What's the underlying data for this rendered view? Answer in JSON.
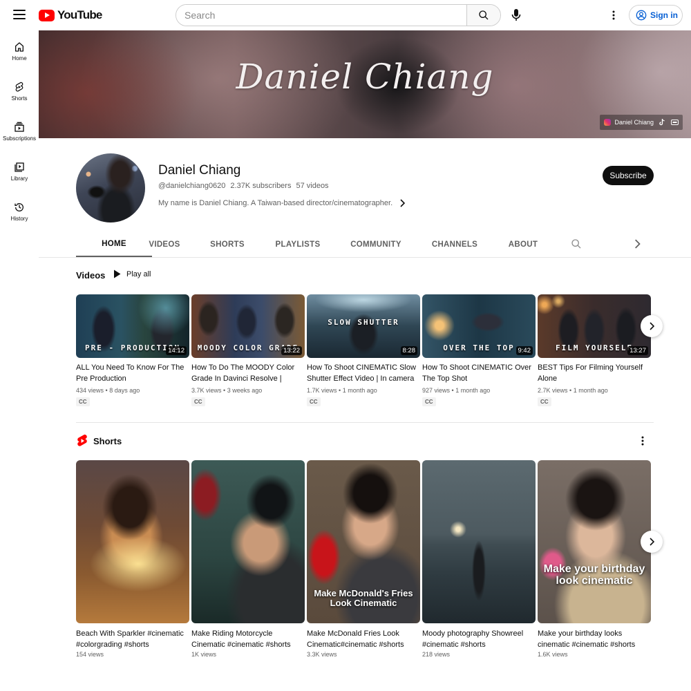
{
  "header": {
    "logo_text": "YouTube",
    "search_placeholder": "Search",
    "sign_in": "Sign in"
  },
  "sidebar": {
    "items": [
      {
        "label": "Home",
        "icon": "home-icon"
      },
      {
        "label": "Shorts",
        "icon": "shorts-icon"
      },
      {
        "label": "Subscriptions",
        "icon": "subscriptions-icon"
      },
      {
        "label": "Library",
        "icon": "library-icon"
      },
      {
        "label": "History",
        "icon": "history-icon"
      }
    ]
  },
  "banner": {
    "title": "Daniel Chiang",
    "links": [
      {
        "label": "Daniel Chiang",
        "icon": "instagram-icon"
      },
      {
        "label": "",
        "icon": "tiktok-icon"
      },
      {
        "label": "",
        "icon": "link-icon"
      }
    ]
  },
  "channel": {
    "name": "Daniel Chiang",
    "handle": "@danielchiang0620",
    "subscribers": "2.37K subscribers",
    "videos_count": "57 videos",
    "description": "My name is Daniel Chiang. A Taiwan-based director/cinematographer.",
    "subscribe_label": "Subscribe"
  },
  "tabs": [
    "HOME",
    "VIDEOS",
    "SHORTS",
    "PLAYLISTS",
    "COMMUNITY",
    "CHANNELS",
    "ABOUT"
  ],
  "active_tab": "HOME",
  "videos_section": {
    "title": "Videos",
    "play_all": "Play all",
    "items": [
      {
        "title": "ALL You Need To Know For The Pre Production",
        "views": "434 views",
        "age": "8 days ago",
        "duration": "14:12",
        "badge": "CC",
        "thumb_text": "PRE - PRODUCTION"
      },
      {
        "title": "How To Do The MOODY Color Grade In Davinci Resolve | Complete tutorial",
        "views": "3.7K views",
        "age": "3 weeks ago",
        "duration": "13:22",
        "badge": "CC",
        "thumb_text": "MOODY COLOR GRADE"
      },
      {
        "title": "How To Shoot CINEMATIC Slow Shutter Effect Video | In camera technique",
        "views": "1.7K views",
        "age": "1 month ago",
        "duration": "8:28",
        "badge": "CC",
        "thumb_text": "SLOW       SHUTTER"
      },
      {
        "title": "How To Shoot CINEMATIC Over The Top Shot",
        "views": "927 views",
        "age": "1 month ago",
        "duration": "9:42",
        "badge": "CC",
        "thumb_text": "OVER THE TOP"
      },
      {
        "title": "BEST Tips For Filming Yourself Alone",
        "views": "2.7K views",
        "age": "1 month ago",
        "duration": "13:27",
        "badge": "CC",
        "thumb_text": "FILM YOURSELF"
      }
    ]
  },
  "shorts_section": {
    "title": "Shorts",
    "items": [
      {
        "title": "Beach With Sparkler #cinematic #colorgrading #shorts",
        "views": "154 views",
        "overlay": ""
      },
      {
        "title": "Make Riding Motorcycle Cinematic #cinematic #shorts",
        "views": "1K views",
        "overlay": ""
      },
      {
        "title": "Make McDonald Fries Look Cinematic#cinematic #shorts",
        "views": "3.3K views",
        "overlay": "Make McDonald's Fries Look Cinematic"
      },
      {
        "title": "Moody photography Showreel #cinematic #shorts",
        "views": "218 views",
        "overlay": ""
      },
      {
        "title": "Make your birthday looks cinematic #cinematic #shorts",
        "views": "1.6K views",
        "overlay": "Make your birthday look cinematic"
      }
    ]
  },
  "colors": {
    "brand_red": "#ff0000",
    "link_blue": "#065fd4",
    "text_primary": "#0f0f0f",
    "text_secondary": "#606060"
  }
}
